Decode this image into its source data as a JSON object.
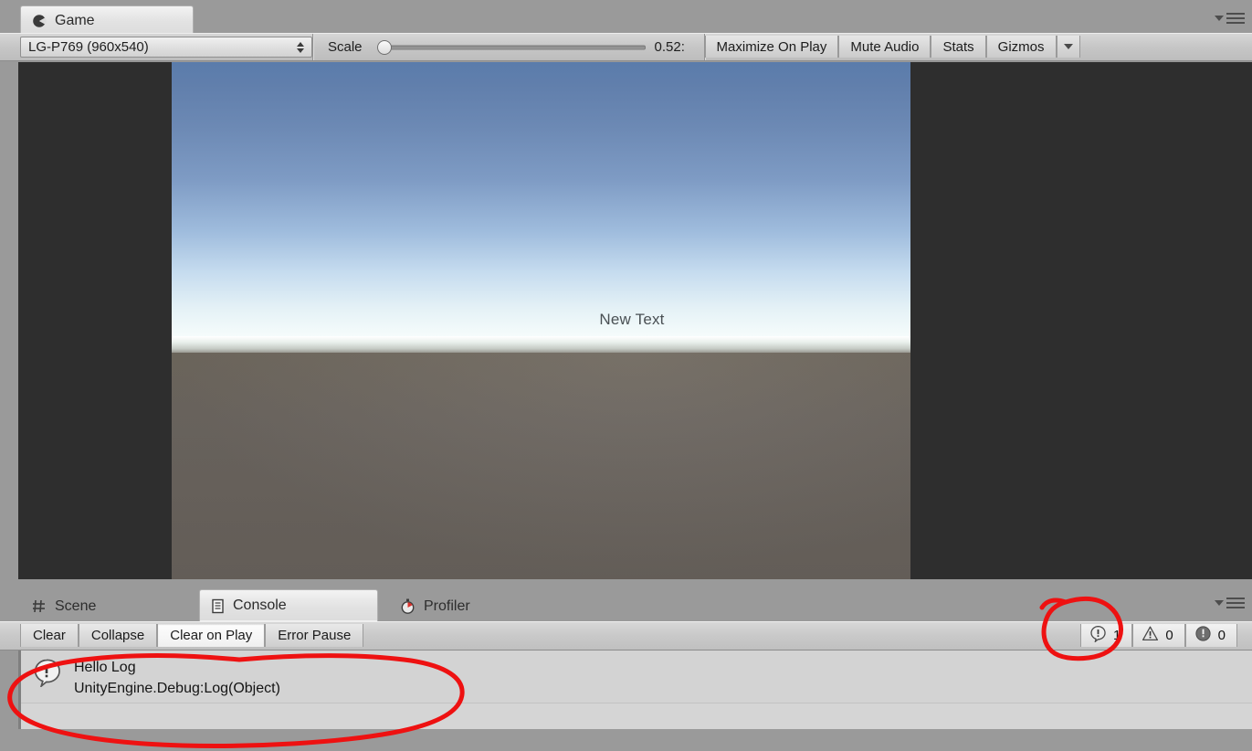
{
  "window": {
    "bg_color": "#9a9a9a",
    "annotation_color": "#ee1111"
  },
  "game_panel": {
    "tab": {
      "label": "Game",
      "icon": "game-pacman-icon",
      "active": true
    },
    "menu_icon": "panel-menu-icon",
    "toolbar": {
      "resolution": {
        "value": "LG-P769 (960x540)",
        "icon": "updown-arrows-icon"
      },
      "scale": {
        "label": "Scale",
        "value": "0.52:",
        "slider_position_pct": 2,
        "min": 0.1,
        "max": 5
      },
      "buttons": [
        {
          "label": "Maximize On Play",
          "name": "maximize-on-play-button",
          "pressed": false
        },
        {
          "label": "Mute Audio",
          "name": "mute-audio-button",
          "pressed": false
        },
        {
          "label": "Stats",
          "name": "stats-button",
          "pressed": false
        },
        {
          "label": "Gizmos",
          "name": "gizmos-button",
          "pressed": false
        }
      ],
      "gizmos_dropdown_icon": "chevron-down-icon"
    },
    "view": {
      "overlay_text": "New Text",
      "sky_top_color": "#5a7cab",
      "sky_horizon_color": "#ffffff",
      "ground_color": "#6a645e",
      "letterbox_color": "#2e2e2e"
    }
  },
  "console_panel": {
    "tabs": [
      {
        "label": "Scene",
        "icon": "grid-hash-icon",
        "active": false,
        "name": "tab-scene"
      },
      {
        "label": "Console",
        "icon": "document-list-icon",
        "active": true,
        "name": "tab-console"
      },
      {
        "label": "Profiler",
        "icon": "stopwatch-icon",
        "active": false,
        "name": "tab-profiler"
      }
    ],
    "menu_icon": "panel-menu-icon",
    "toolbar": {
      "buttons": [
        {
          "label": "Clear",
          "name": "clear-button",
          "pressed": false
        },
        {
          "label": "Collapse",
          "name": "collapse-button",
          "pressed": false
        },
        {
          "label": "Clear on Play",
          "name": "clear-on-play-button",
          "pressed": true
        },
        {
          "label": "Error Pause",
          "name": "error-pause-button",
          "pressed": false
        }
      ],
      "counters": [
        {
          "type": "info",
          "icon": "info-bubble-icon",
          "count": "1"
        },
        {
          "type": "warning",
          "icon": "warning-triangle-icon",
          "count": "0"
        },
        {
          "type": "error",
          "icon": "error-circle-icon",
          "count": "0"
        }
      ]
    },
    "log_entries": [
      {
        "icon": "info-bubble-icon",
        "message": "Hello Log",
        "stacktrace": "UnityEngine.Debug:Log(Object)"
      }
    ]
  },
  "annotations": [
    {
      "name": "annotation-circle-info-counter",
      "target": "info counter"
    },
    {
      "name": "annotation-circle-log-entry",
      "target": "console log entry"
    }
  ]
}
